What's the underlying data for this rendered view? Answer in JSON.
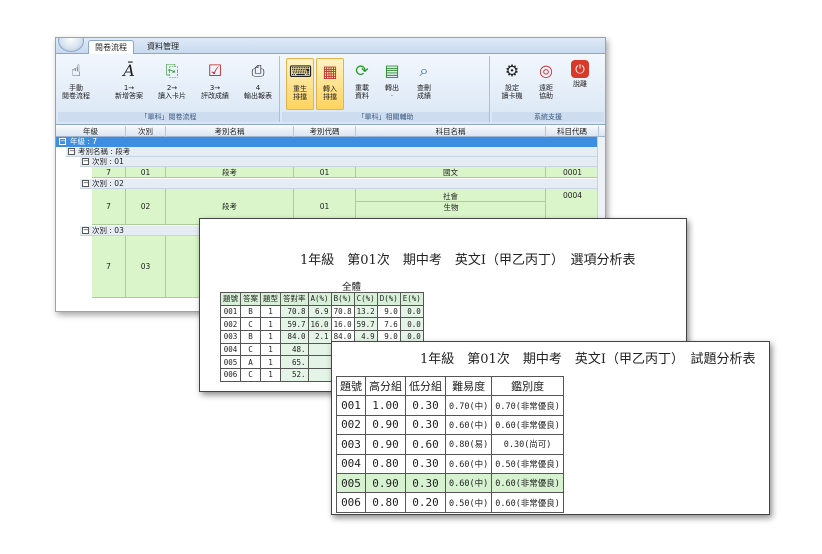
{
  "app": {
    "tabs": [
      "閱卷流程",
      "資料管理"
    ],
    "groups": [
      {
        "title": "「單科」閱卷流程",
        "buttons": [
          {
            "label": "手動\n閱卷流程",
            "icon": "hand-icon"
          },
          {
            "label": "1→\n新增答案",
            "icon": "answer-sheet-icon"
          },
          {
            "label": "2→\n讀入卡片",
            "icon": "card-read-icon"
          },
          {
            "label": "3→\n評改成績",
            "icon": "checklist-icon"
          },
          {
            "label": "4\n輸出報表",
            "icon": "printer-icon"
          }
        ]
      },
      {
        "title": "「單科」相關輔助",
        "buttons": [
          {
            "label": "重生\n排擋",
            "icon": "regenerate-icon"
          },
          {
            "label": "轉入\n排擋",
            "icon": "import-icon"
          },
          {
            "label": "重載\n資料",
            "icon": "reload-icon"
          },
          {
            "label": "轉出\n·",
            "icon": "export-icon"
          },
          {
            "label": "查刪\n成績",
            "icon": "search-icon"
          }
        ]
      },
      {
        "title": "系統支援",
        "buttons": [
          {
            "label": "設定\n讀卡機",
            "icon": "card-reader-icon"
          },
          {
            "label": "遠距\n協助",
            "icon": "lifebuoy-icon"
          },
          {
            "label": "說離",
            "icon": "power-icon"
          }
        ]
      }
    ],
    "grid": {
      "columns": [
        "年級",
        "次別",
        "考別名稱",
        "考別代碼",
        "科目名稱",
        "科目代碼"
      ],
      "group_level1": "年級 : 7",
      "group_level2": "考別名稱 : 段考",
      "group_level3a": "次別 : 01",
      "group_level3b": "次別 : 02",
      "group_level3c": "次別 : 03",
      "row1": [
        "7",
        "01",
        "段考",
        "01",
        "國文",
        "0001"
      ],
      "row2": [
        "7",
        "02",
        "段考",
        "01",
        "社會",
        "0004"
      ],
      "row2_extra": "生物",
      "row3": [
        "7",
        "03",
        "",
        "",
        "",
        ""
      ]
    }
  },
  "report1": {
    "title": "1年級　第01次　期中考　英文I（甲乙丙丁）　選項分析表",
    "subtitle": "全體",
    "headers": [
      "題號",
      "答案",
      "題型",
      "答對率",
      "A(%)",
      "B(%)",
      "C(%)",
      "D(%)",
      "E(%)"
    ],
    "rows": [
      [
        "001",
        "B",
        "1",
        "70.8",
        "6.9",
        "70.8",
        "13.2",
        "9.0",
        "0.0"
      ],
      [
        "002",
        "C",
        "1",
        "59.7",
        "16.0",
        "16.0",
        "59.7",
        "7.6",
        "0.0"
      ],
      [
        "003",
        "B",
        "1",
        "84.0",
        "2.1",
        "84.0",
        "4.9",
        "9.0",
        "0.0"
      ],
      [
        "004",
        "C",
        "1",
        "48.",
        "",
        "",
        "",
        "",
        ""
      ],
      [
        "005",
        "A",
        "1",
        "65.",
        "",
        "",
        "",
        "",
        ""
      ],
      [
        "006",
        "C",
        "1",
        "52.",
        "",
        "",
        "",
        "",
        ""
      ]
    ]
  },
  "report2": {
    "title": "1年級　第01次　期中考　英文I（甲乙丙丁）　試題分析表",
    "headers": [
      "題號",
      "高分組",
      "低分組",
      "難易度",
      "鑑別度"
    ],
    "rows": [
      [
        "001",
        "1.00",
        "0.30",
        "0.70(中)",
        "0.70(非常優良)"
      ],
      [
        "002",
        "0.90",
        "0.30",
        "0.60(中)",
        "0.60(非常優良)"
      ],
      [
        "003",
        "0.90",
        "0.60",
        "0.80(易)",
        "0.30(尚可)"
      ],
      [
        "004",
        "0.80",
        "0.30",
        "0.60(中)",
        "0.50(非常優良)"
      ],
      [
        "005",
        "0.90",
        "0.30",
        "0.60(中)",
        "0.60(非常優良)"
      ],
      [
        "006",
        "0.80",
        "0.20",
        "0.50(中)",
        "0.60(非常優良)"
      ]
    ],
    "highlight_row_index": 4
  },
  "colors": {
    "accent": "#3d8ee0",
    "row_green": "#d9f5c9",
    "ribbon_highlight": "#ffd35e"
  }
}
